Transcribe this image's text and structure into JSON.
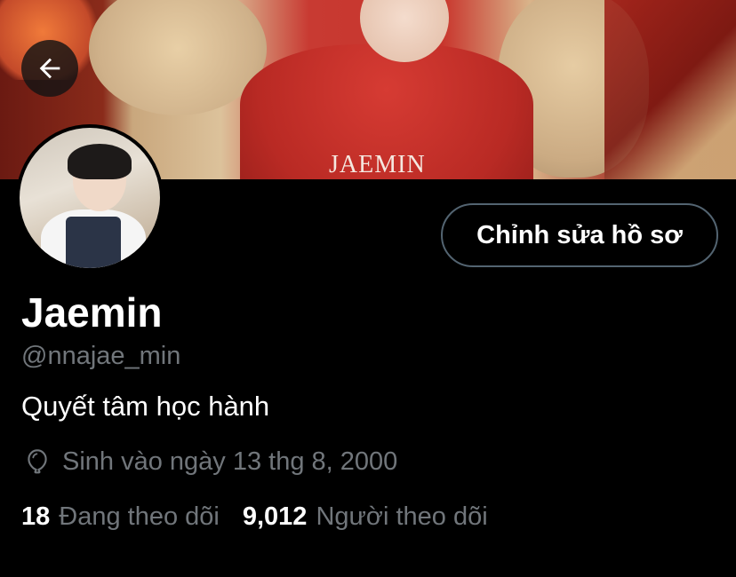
{
  "profile": {
    "display_name": "Jaemin",
    "handle": "@nnajae_min",
    "bio": "Quyết tâm học hành",
    "birthday": "Sinh vào ngày 13 thg 8, 2000",
    "edit_button_label": "Chỉnh sửa hồ sơ",
    "following_count": "18",
    "following_label": "Đang theo dõi",
    "followers_count": "9,012",
    "followers_label": "Người theo dõi"
  },
  "banner": {
    "shirt_text": "JAEMIN"
  },
  "icons": {
    "back": "arrow-left-icon",
    "birthday": "balloon-icon"
  },
  "colors": {
    "background": "#000000",
    "text_primary": "#ffffff",
    "text_secondary": "#71767b",
    "button_border": "#536471"
  }
}
